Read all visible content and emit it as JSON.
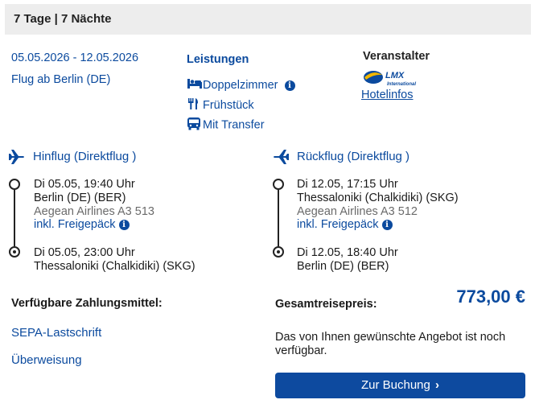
{
  "header": {
    "title": "7 Tage | 7 Nächte"
  },
  "travel": {
    "dates": "05.05.2026 - 12.05.2026",
    "departure": "Flug ab Berlin (DE)"
  },
  "services": {
    "title": "Leistungen",
    "items": [
      {
        "label": "Doppelzimmer",
        "icon": "bed-icon",
        "info": true
      },
      {
        "label": "Frühstück",
        "icon": "cutlery-icon"
      },
      {
        "label": "Mit Transfer",
        "icon": "bus-icon"
      }
    ]
  },
  "operator": {
    "title": "Veranstalter",
    "logo_text": "LMX",
    "logo_subtext": "International",
    "link": "Hotelinfos"
  },
  "outbound": {
    "title": "Hinflug (Direktflug )",
    "dep_time": "Di 05.05, 19:40 Uhr",
    "dep_airport": "Berlin (DE) (BER)",
    "airline": "Aegean Airlines A3 513",
    "baggage": "inkl. Freigepäck",
    "arr_time": "Di 05.05, 23:00 Uhr",
    "arr_airport": "Thessaloniki (Chalkidiki) (SKG)"
  },
  "return": {
    "title": "Rückflug (Direktflug )",
    "dep_time": "Di 12.05, 17:15 Uhr",
    "dep_airport": "Thessaloniki (Chalkidiki) (SKG)",
    "airline": "Aegean Airlines A3 512",
    "baggage": "inkl. Freigepäck",
    "arr_time": "Di 12.05, 18:40 Uhr",
    "arr_airport": "Berlin (DE) (BER)"
  },
  "payment": {
    "title": "Verfügbare Zahlungsmittel:",
    "methods": [
      "SEPA-Lastschrift",
      "Überweisung"
    ]
  },
  "price": {
    "label": "Gesamtreisepreis:",
    "value": "773,00 €",
    "availability": "Das von Ihnen gewünschte Angebot ist noch verfügbar.",
    "button": "Zur Buchung"
  },
  "colors": {
    "accent": "#0b4a9e",
    "button": "#0d4a9f",
    "header_bg": "#ededed"
  }
}
